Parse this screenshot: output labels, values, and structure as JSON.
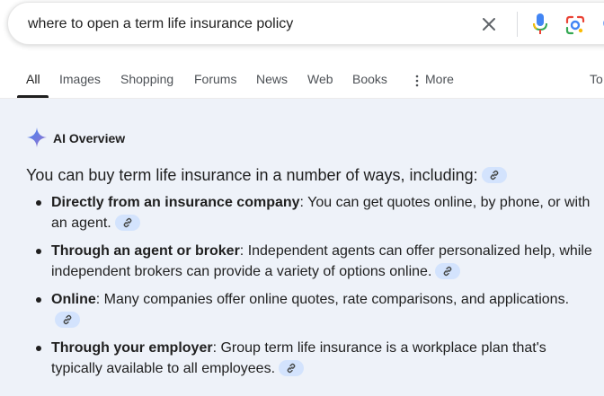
{
  "search": {
    "query": "where to open a term life insurance policy"
  },
  "tabs": [
    {
      "label": "All",
      "active": true
    },
    {
      "label": "Images"
    },
    {
      "label": "Shopping"
    },
    {
      "label": "Forums"
    },
    {
      "label": "News"
    },
    {
      "label": "Web"
    },
    {
      "label": "Books"
    },
    {
      "label": "More"
    },
    {
      "label": "To"
    }
  ],
  "ai_overview": {
    "title": "AI Overview",
    "lead": "You can buy term life insurance in a number of ways, including:",
    "bullets": [
      {
        "term": "Directly from an insurance company",
        "text": ": You can get quotes online, by phone, or with an agent."
      },
      {
        "term": "Through an agent or broker",
        "text": ": Independent agents can offer personalized help, while independent brokers can provide a variety of options online."
      },
      {
        "term": "Online",
        "text": ": Many companies offer online quotes, rate comparisons, and applications."
      },
      {
        "term": "Through your employer",
        "text": ": Group term life insurance is a workplace plan that's typically available to all employees."
      }
    ]
  },
  "icons": {
    "clear": "close-icon",
    "voice": "microphone-icon",
    "lens": "google-lens-icon",
    "search": "search-icon",
    "more": "vertical-dots-icon",
    "sparkle": "gemini-sparkle-icon",
    "link": "link-icon"
  },
  "colors": {
    "panel_bg": "#eef2f9",
    "chip_bg": "#d3e3fd",
    "google_blue": "#4285f4",
    "google_red": "#ea4335",
    "google_yellow": "#fbbc04",
    "google_green": "#34a853"
  }
}
